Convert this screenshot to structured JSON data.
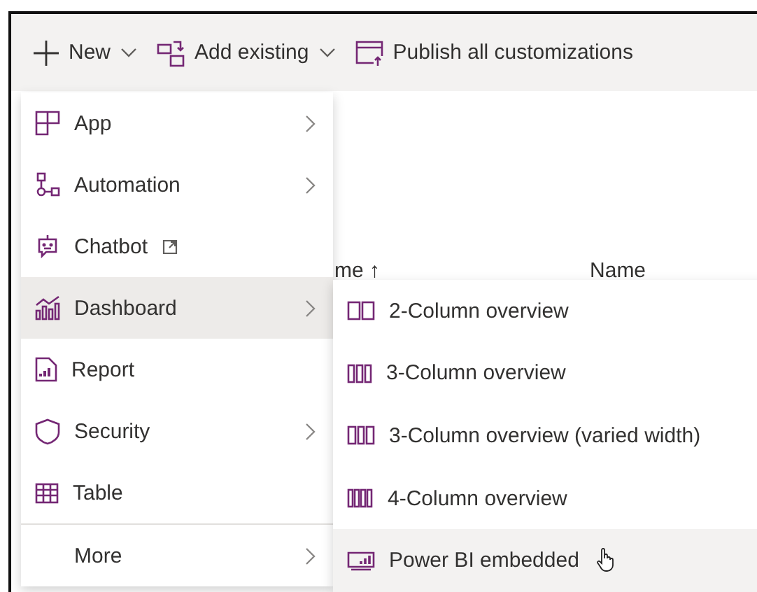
{
  "toolbar": [
    {
      "label": "New",
      "dropdown": true
    },
    {
      "label": "Add existing",
      "dropdown": true
    },
    {
      "label": "Publish all customizations",
      "dropdown": false
    }
  ],
  "table": {
    "columns": [
      "me ↑",
      "Name"
    ]
  },
  "menu": {
    "items": [
      {
        "label": "App",
        "submenu": true,
        "external": false,
        "selected": false
      },
      {
        "label": "Automation",
        "submenu": true,
        "external": false,
        "selected": false
      },
      {
        "label": "Chatbot",
        "submenu": false,
        "external": true,
        "selected": false
      },
      {
        "label": "Dashboard",
        "submenu": true,
        "external": false,
        "selected": true
      },
      {
        "label": "Report",
        "submenu": false,
        "external": false,
        "selected": false
      },
      {
        "label": "Security",
        "submenu": true,
        "external": false,
        "selected": false
      },
      {
        "label": "Table",
        "submenu": false,
        "external": false,
        "selected": false
      },
      {
        "label": "More",
        "submenu": true,
        "external": false,
        "selected": false
      }
    ]
  },
  "submenu": {
    "items": [
      {
        "label": "2-Column overview",
        "selected": false
      },
      {
        "label": "3-Column overview",
        "selected": false
      },
      {
        "label": "3-Column overview (varied width)",
        "selected": false
      },
      {
        "label": "4-Column overview",
        "selected": false
      },
      {
        "label": "Power BI embedded",
        "selected": true
      }
    ]
  }
}
